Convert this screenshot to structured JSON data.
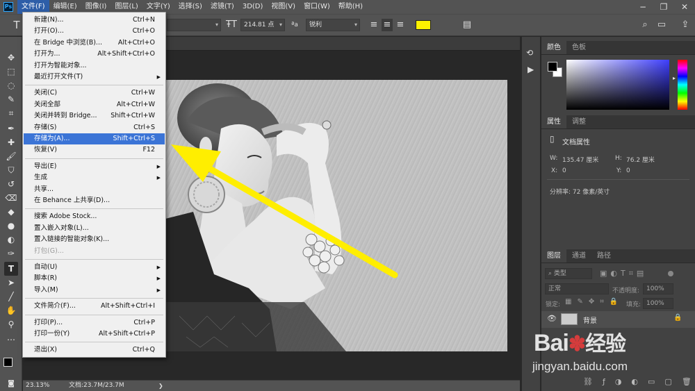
{
  "menubar": {
    "logo": "Ps",
    "items": [
      "文件(F)",
      "编辑(E)",
      "图像(I)",
      "图层(L)",
      "文字(Y)",
      "选择(S)",
      "滤镜(T)",
      "3D(D)",
      "视图(V)",
      "窗口(W)",
      "帮助(H)"
    ],
    "active_index": 0
  },
  "options": {
    "font_size": "214.81 点",
    "antialias": "锐利",
    "text_color": "#fff200"
  },
  "file_menu": [
    {
      "label": "新建(N)...",
      "shortcut": "Ctrl+N"
    },
    {
      "label": "打开(O)...",
      "shortcut": "Ctrl+O"
    },
    {
      "label": "在 Bridge 中浏览(B)...",
      "shortcut": "Alt+Ctrl+O"
    },
    {
      "label": "打开为...",
      "shortcut": "Alt+Shift+Ctrl+O"
    },
    {
      "label": "打开为智能对象...",
      "shortcut": ""
    },
    {
      "label": "最近打开文件(T)",
      "shortcut": "",
      "submenu": true
    },
    {
      "label": "关闭(C)",
      "shortcut": "Ctrl+W"
    },
    {
      "label": "关闭全部",
      "shortcut": "Alt+Ctrl+W"
    },
    {
      "label": "关闭并转到 Bridge...",
      "shortcut": "Shift+Ctrl+W"
    },
    {
      "label": "存储(S)",
      "shortcut": "Ctrl+S"
    },
    {
      "label": "存储为(A)...",
      "shortcut": "Shift+Ctrl+S",
      "highlighted": true
    },
    {
      "label": "恢复(V)",
      "shortcut": "F12"
    },
    {
      "label": "导出(E)",
      "shortcut": "",
      "submenu": true
    },
    {
      "label": "生成",
      "shortcut": "",
      "submenu": true
    },
    {
      "label": "共享...",
      "shortcut": ""
    },
    {
      "label": "在 Behance 上共享(D)...",
      "shortcut": ""
    },
    {
      "label": "搜索 Adobe Stock...",
      "shortcut": ""
    },
    {
      "label": "置入嵌入对象(L)...",
      "shortcut": ""
    },
    {
      "label": "置入链接的智能对象(K)...",
      "shortcut": ""
    },
    {
      "label": "打包(G)...",
      "shortcut": "",
      "disabled": true
    },
    {
      "label": "自动(U)",
      "shortcut": "",
      "submenu": true
    },
    {
      "label": "脚本(R)",
      "shortcut": "",
      "submenu": true
    },
    {
      "label": "导入(M)",
      "shortcut": "",
      "submenu": true
    },
    {
      "label": "文件简介(F)...",
      "shortcut": "Alt+Shift+Ctrl+I"
    },
    {
      "label": "打印(P)...",
      "shortcut": "Ctrl+P"
    },
    {
      "label": "打印一份(Y)",
      "shortcut": "Alt+Shift+Ctrl+P"
    },
    {
      "label": "退出(X)",
      "shortcut": "Ctrl+Q"
    }
  ],
  "status": {
    "zoom": "23.13%",
    "doc": "文档:23.7M/23.7M"
  },
  "color_panel": {
    "tabs": [
      "颜色",
      "色板"
    ]
  },
  "properties_panel": {
    "tabs": [
      "属性",
      "调整"
    ],
    "section": "文档属性",
    "w_label": "W:",
    "w_value": "135.47 厘米",
    "h_label": "H:",
    "h_value": "76.2 厘米",
    "x_label": "X:",
    "x_value": "0",
    "y_label": "Y:",
    "y_value": "0",
    "resolution": "分辨率: 72 像素/英寸"
  },
  "layers_panel": {
    "tabs": [
      "图层",
      "通道",
      "路径"
    ],
    "filter_label": "类型",
    "blend_mode": "正常",
    "opacity_label": "不透明度:",
    "opacity_value": "100%",
    "lock_label": "锁定:",
    "fill_label": "填充:",
    "fill_value": "100%",
    "layer_name": "背景"
  },
  "watermark": {
    "brand": "Bai",
    "brand2": "经验",
    "url": "jingyan.baidu.com"
  },
  "colors": {
    "arrow": "#ffee00",
    "highlight": "#3b74d6"
  }
}
